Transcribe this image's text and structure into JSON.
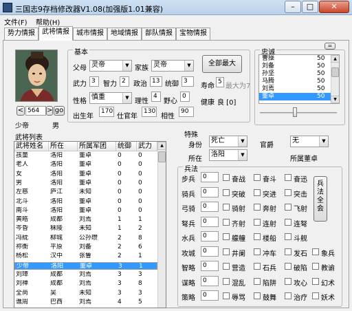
{
  "window": {
    "title": "三国志9存档修改器V1.08(加强版1.01兼容)",
    "minimize": "–",
    "maximize": "□",
    "close": "✕"
  },
  "menu": {
    "file": "文件(F)",
    "help": "帮助(H)"
  },
  "tabs": [
    "势力情报",
    "武将情报",
    "城市情报",
    "地域情报",
    "部队情报",
    "宝物情报"
  ],
  "active_tab": "武将情报",
  "portrait": {
    "id_label": "564",
    "prev": "<",
    "next": ">",
    "go": "go",
    "name": "少帝",
    "gender": "男"
  },
  "basic": {
    "title": "基本",
    "father_label": "父母",
    "father_value": "灵帝",
    "family_label": "家族",
    "family_value": "灵帝",
    "stat_labels": {
      "war": "武力",
      "int": "智力",
      "pol": "政治",
      "lead": "统御"
    },
    "stats": {
      "war": "3",
      "int": "2",
      "pol": "13",
      "lead": "3"
    },
    "personality_label": "性格",
    "personality_value": "慎重",
    "ri_label": "理性",
    "ri_value": "4",
    "ambition_label": "野心",
    "ambition_value": "0",
    "birth_label": "出生年",
    "birth_value": "170",
    "service_label": "仕官年",
    "service_value": "130",
    "compat_label": "相性",
    "compat_value": "90",
    "max_all_button": "全部最大",
    "life_label": "寿命",
    "life_value": "5",
    "life_max": "最大为7",
    "health_label": "健康",
    "health_value": "良 [0]"
  },
  "loyalty": {
    "title": "忠诚",
    "items": [
      {
        "name": "曹操",
        "value": "50"
      },
      {
        "name": "刘备",
        "value": "50"
      },
      {
        "name": "孙坚",
        "value": "50"
      },
      {
        "name": "马腾",
        "value": "50"
      },
      {
        "name": "刘焉",
        "value": "50"
      },
      {
        "name": "董卓",
        "value": "50"
      }
    ],
    "selected": "董卓",
    "slider_value": "50",
    "small_button": "="
  },
  "officer_list": {
    "title": "武将列表",
    "columns": [
      "武将姓名",
      "所在",
      "所属军团",
      "统御",
      "武力"
    ],
    "rows": [
      [
        "孩童",
        "洛阳",
        "董卓",
        "0",
        "0"
      ],
      [
        "老人",
        "洛阳",
        "董卓",
        "0",
        "0"
      ],
      [
        "女",
        "洛阳",
        "董卓",
        "0",
        "0"
      ],
      [
        "男",
        "洛阳",
        "董卓",
        "0",
        "0"
      ],
      [
        "左慈",
        "庐江",
        "未知",
        "0",
        "0"
      ],
      [
        "北斗",
        "洛阳",
        "董卓",
        "0",
        "0"
      ],
      [
        "南斗",
        "洛阳",
        "董卓",
        "0",
        "0"
      ],
      [
        "黄皓",
        "成都",
        "刘焉",
        "1",
        "1"
      ],
      [
        "岑昏",
        "秣陵",
        "未知",
        "1",
        "2"
      ],
      [
        "冯紞",
        "柳城",
        "公孙瓒",
        "2",
        "8"
      ],
      [
        "祢衡",
        "平原",
        "刘备",
        "2",
        "6"
      ],
      [
        "杨松",
        "汉中",
        "张鲁",
        "2",
        "1"
      ],
      [
        "少帝",
        "洛阳",
        "董卓",
        "3",
        "1"
      ],
      [
        "刘璋",
        "成都",
        "刘焉",
        "3",
        "3"
      ],
      [
        "刘禅",
        "成都",
        "刘焉",
        "3",
        "8"
      ],
      [
        "全尚",
        "吴",
        "未知",
        "3",
        "3"
      ],
      [
        "谯周",
        "巴西",
        "刘焉",
        "4",
        "5"
      ]
    ],
    "selected_row": 12
  },
  "special": {
    "title": "特殊",
    "identity_label": "身份",
    "identity_value": "死亡",
    "rank_label": "官爵",
    "rank_value": "无",
    "location_label": "所在",
    "location_value": "洛阳",
    "corps_label": "所属董卓"
  },
  "tactics": {
    "title": "兵法",
    "all_button": "兵法全会",
    "rows": [
      {
        "label": "步兵",
        "value": "0",
        "skills": [
          "奋战",
          "奋斗",
          "奋迅"
        ]
      },
      {
        "label": "骑兵",
        "value": "0",
        "skills": [
          "突破",
          "突进",
          "突击"
        ]
      },
      {
        "label": "弓骑",
        "value": "0",
        "skills": [
          "骑射",
          "奔射",
          "飞射"
        ]
      },
      {
        "label": "弩兵",
        "value": "0",
        "skills": [
          "齐射",
          "连射",
          "连弩"
        ]
      },
      {
        "label": "水兵",
        "value": "0",
        "skills": [
          "艨艟",
          "楼船",
          "斗舰"
        ]
      },
      {
        "label": "攻城",
        "value": "0",
        "skills": [
          "井阑",
          "冲车",
          "发石",
          "象兵"
        ]
      },
      {
        "label": "智略",
        "value": "0",
        "skills": [
          "营造",
          "石兵",
          "破陷",
          "教谕"
        ]
      },
      {
        "label": "谋略",
        "value": "0",
        "skills": [
          "混乱",
          "陷阱",
          "攻心",
          "幻术"
        ]
      },
      {
        "label": "策略",
        "value": "0",
        "skills": [
          "辱骂",
          "鼓舞",
          "治疗",
          "妖术"
        ]
      }
    ]
  },
  "colors": {
    "accent": "#3399ff",
    "titlebar": "#b9d1ea"
  }
}
